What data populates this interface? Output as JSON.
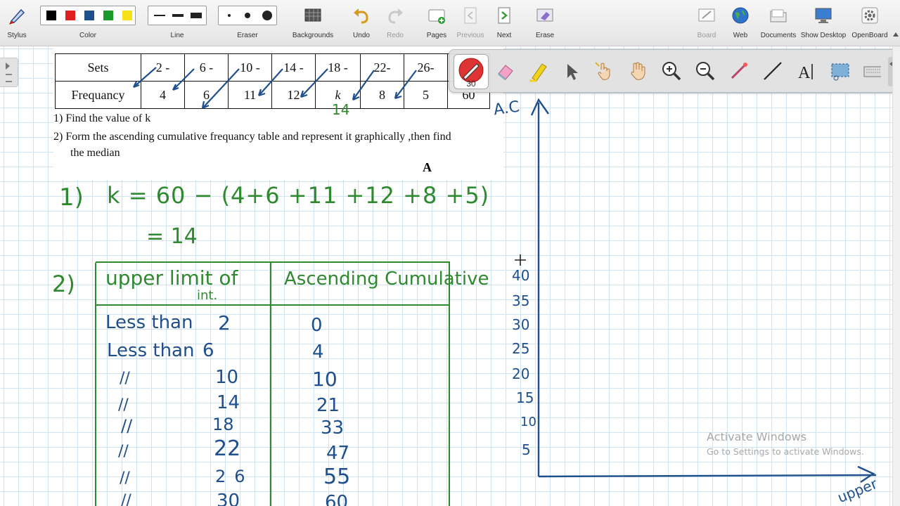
{
  "toolbar": {
    "stylus": "Stylus",
    "color": "Color",
    "line": "Line",
    "eraser": "Eraser",
    "backgrounds": "Backgrounds",
    "undo": "Undo",
    "redo": "Redo",
    "pages": "Pages",
    "previous": "Previous",
    "next": "Next",
    "erase": "Erase",
    "board": "Board",
    "web": "Web",
    "documents": "Documents",
    "show_desktop": "Show Desktop",
    "openboard": "OpenBoard",
    "colors": [
      "#000000",
      "#e02020",
      "#1f4f8c",
      "#1a9a2a",
      "#f6e21b"
    ]
  },
  "pen_toolbar": {
    "selected_tool": "pen",
    "zoom_readout": "30",
    "tools": [
      "pen-icon",
      "eraser-icon",
      "highlighter-icon",
      "pointer-icon",
      "laser-hand-icon",
      "hand-icon",
      "zoom-in-icon",
      "zoom-out-icon",
      "line-stylus-icon",
      "line-icon",
      "text-icon",
      "capture-icon",
      "keyboard-icon"
    ]
  },
  "document": {
    "table": {
      "header_sets": "Sets",
      "header_freq": "Frequancy",
      "sets": [
        "2 -",
        "6 -",
        "10 -",
        "14 -",
        "18 -",
        "22-",
        "26-"
      ],
      "frequencies": [
        "4",
        "6",
        "11",
        "12",
        "k",
        "8",
        "5"
      ],
      "last_cell": "60"
    },
    "question_1": "1)  Find the value of k",
    "question_2_line1": "2)  Form the ascending cumulative frequancy table and represent it graphically ,then find",
    "question_2_line2": "the median",
    "marker": "A"
  },
  "handwriting": {
    "k_written": "14",
    "step1_label": "1)",
    "step1_eq": "k = 60 − (4+6 +11 +12 +8 +5)",
    "step1_result": "= 14",
    "step2_label": "2)",
    "col1_header_line1": "upper limit of",
    "col1_header_line2": "int.",
    "col2_header": "Ascending Cumulative",
    "rows": [
      {
        "label": "Less than",
        "limit": "2",
        "cum": "0"
      },
      {
        "label": "Less than",
        "limit": "6",
        "cum": "4"
      },
      {
        "label": "//",
        "limit": "10",
        "cum": "10"
      },
      {
        "label": "//",
        "limit": "14",
        "cum": "21"
      },
      {
        "label": "//",
        "limit": "18",
        "cum": "33"
      },
      {
        "label": "//",
        "limit": "22",
        "cum": "47"
      },
      {
        "label": "//",
        "limit": "26",
        "cum": "55"
      },
      {
        "label": "//",
        "limit": "30",
        "cum": "60"
      }
    ]
  },
  "graph": {
    "y_axis_label": "A.C",
    "x_axis_label": "upper",
    "y_ticks": [
      "40",
      "35",
      "30",
      "25",
      "20",
      "15",
      "10",
      "5"
    ]
  },
  "watermark": {
    "line1": "Activate Windows",
    "line2": "Go to Settings to activate Windows."
  }
}
